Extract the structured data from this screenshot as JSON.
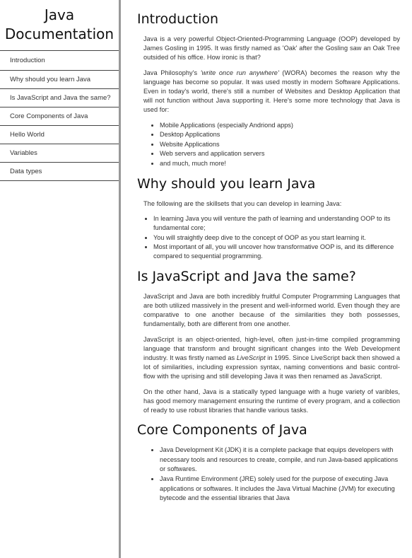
{
  "nav": {
    "title_line1": "Java",
    "title_line2": "Documentation",
    "items": [
      "Introduction",
      "Why should you learn Java",
      "Is JavaScript and Java the same?",
      "Core Components of Java",
      "Hello World",
      "Variables",
      "Data types"
    ]
  },
  "intro": {
    "header": "Introduction",
    "p1": "Java is a very powerful Object-Oriented-Programming Language (OOP) developed by James Gosling in 1995. It was firstly named as 'Oak' after the Gosling saw an Oak Tree outsided of his office. How ironic is that?",
    "p2_before": "Java Philosophy's ",
    "p2_em": "'write once run anywhere'",
    "p2_after": " (WORA) becomes the reason why the language has become so popular. It was used mostly in modern Software Applications. Even in today's world, there's still a number of Websites and Desktop Application that will not function without Java supporting it. Here's some more technology that Java is used for:",
    "list": [
      "Mobile Applications (especially Andriond apps)",
      "Desktop Applications",
      "Website Applications",
      "Web servers and application servers",
      "and much, much more!"
    ]
  },
  "why": {
    "header": "Why should you learn Java",
    "p1": "The following are the skillsets that you can develop in learning Java:",
    "list": [
      "In learning Java you will venture the path of learning and understanding OOP to its fundamental core;",
      "You will straightly deep dive to the concept of OOP as you start learning it.",
      "Most important of all, you will uncover how transformative OOP is, and its difference compared to sequential programming."
    ]
  },
  "jsjava": {
    "header": "Is JavaScript and Java the same?",
    "p1": "JavaScript and Java are both incredibly fruitful Computer Programming Languages that are both utilized massively in the present and well-informed world. Even though they are comparative to one another because of the similarities they both possesses, fundamentally, both are different from one another.",
    "p2_before": "JavaScript is an object-oriented, high-level, often just-in-time compiled programming language that transform and brought significant changes into the Web Development industry. It was firstly named as ",
    "p2_em": "LiveScript",
    "p2_after": " in 1995. Since LiveScript back then showed a lot of similarities, including expression syntax, naming conventions and basic control-flow with the uprising and still developing Java it was then renamed as JavaScript.",
    "p3": "On the other hand, Java is a statically typed language with a huge variety of varibles, has good memory management ensuring the runtime of every program, and a collection of ready to use robust libraries that handle various tasks."
  },
  "core": {
    "header": "Core Components of Java",
    "list": [
      "Java Development Kit (JDK) it is a complete package that equips developers with necessary tools and resources to create, compile, and run Java-based applications or softwares.",
      "Java Runtime Environment (JRE) solely used for the purpose of executing Java applications or softwares. It includes the Java Virtual Machine (JVM) for executing bytecode and the essential libraries that Java"
    ]
  }
}
